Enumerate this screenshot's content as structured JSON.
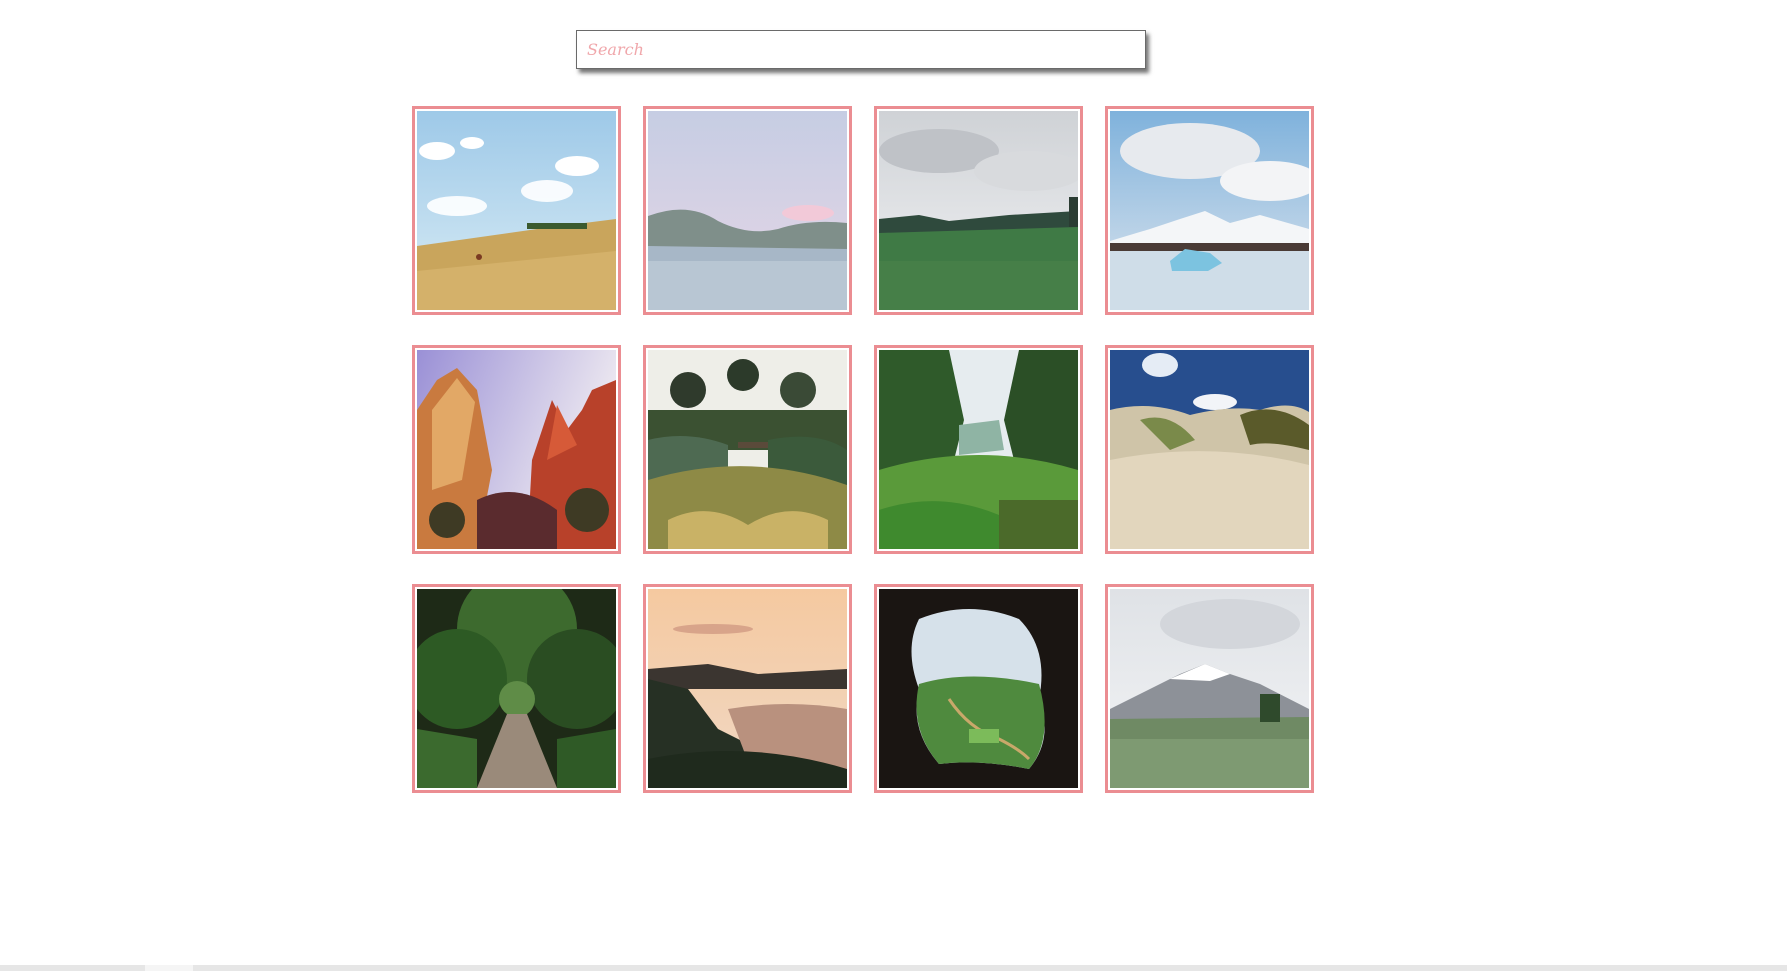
{
  "search": {
    "placeholder": "Search",
    "value": ""
  },
  "gallery": {
    "border_color": "#eb8d92",
    "images": [
      {
        "name": "wheat-field-image"
      },
      {
        "name": "mountain-lake-image"
      },
      {
        "name": "green-grassland-image"
      },
      {
        "name": "glacier-lagoon-image"
      },
      {
        "name": "red-canyon-image"
      },
      {
        "name": "garden-trees-image"
      },
      {
        "name": "jungle-valley-image"
      },
      {
        "name": "sand-dunes-image"
      },
      {
        "name": "forest-path-image"
      },
      {
        "name": "coastal-sunset-image"
      },
      {
        "name": "cave-view-image"
      },
      {
        "name": "snowy-mountain-meadow-image"
      }
    ]
  }
}
